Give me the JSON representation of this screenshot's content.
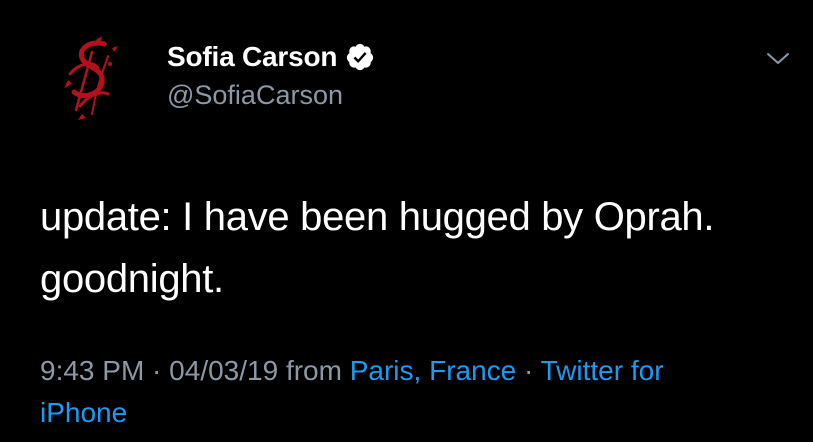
{
  "colors": {
    "background": "#000000",
    "text_primary": "#ffffff",
    "text_secondary": "#8b98a5",
    "link": "#1d9bf0",
    "verified_badge": "#ffffff",
    "avatar_mark": "#b3111b"
  },
  "author": {
    "display_name": "Sofia Carson",
    "handle": "@SofiaCarson",
    "verified_icon": "verified-badge-icon",
    "avatar_icon": "sofia-carson-monogram-logo"
  },
  "menu": {
    "icon": "chevron-down-icon"
  },
  "tweet": {
    "line1": "update: I have been hugged by Oprah.",
    "line2": "goodnight."
  },
  "meta": {
    "time": "9:43 PM",
    "separator1": " · ",
    "date": "04/03/19",
    "from_text": " from ",
    "location": "Paris, France",
    "separator2": " · ",
    "source_part1": "Twitter for",
    "source_part2": "iPhone"
  }
}
